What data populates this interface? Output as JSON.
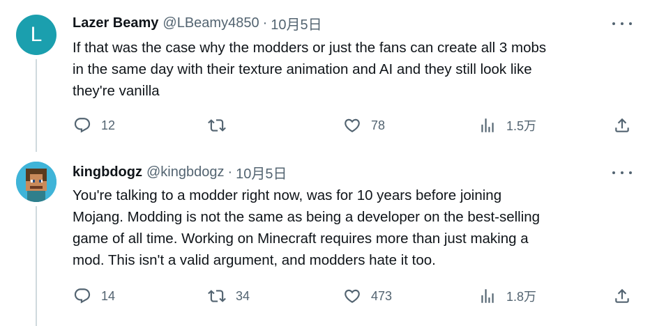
{
  "tweets": [
    {
      "avatar_letter": "L",
      "name": "Lazer Beamy",
      "handle": "@LBeamy4850",
      "separator": "·",
      "date": "10月5日",
      "text": "If that was the case why the modders or just the fans can create all 3 mobs\nin the same day with their texture animation and AI and they still look like\nthey're vanilla",
      "replies": "12",
      "retweets": "",
      "likes": "78",
      "views": "1.5万"
    },
    {
      "name": "kingbdogz",
      "handle": "@kingbdogz",
      "separator": "·",
      "date": "10月5日",
      "text": "You're talking to a modder right now, was for 10 years before joining\nMojang. Modding is not the same as being a developer on the best-selling\ngame of all time. Working on Minecraft requires more than just making a\nmod. This isn't a valid argument, and modders hate it too.",
      "replies": "14",
      "retweets": "34",
      "likes": "473",
      "views": "1.8万"
    }
  ],
  "colors": {
    "avatar_teal": "#1b9fae",
    "muted": "#536471",
    "text": "#0f1419",
    "thread": "#cfd9de"
  }
}
